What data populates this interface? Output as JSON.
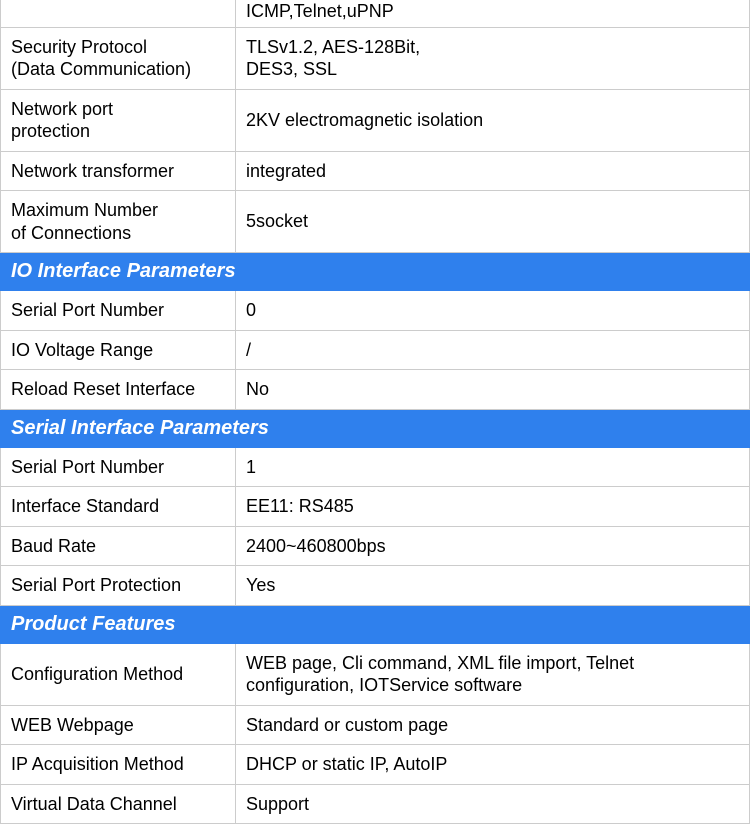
{
  "top_partial": {
    "label": "",
    "value": "ICMP,Telnet,uPNP"
  },
  "pre_rows": [
    {
      "label": "Security Protocol\n(Data Communication)",
      "value": "TLSv1.2, AES-128Bit,\nDES3, SSL"
    },
    {
      "label": "Network port\nprotection",
      "value": "2KV electromagnetic isolation"
    },
    {
      "label": "Network transformer",
      "value": "integrated"
    },
    {
      "label": "Maximum Number\nof Connections",
      "value": "5socket"
    }
  ],
  "sections": [
    {
      "title": "IO Interface Parameters",
      "rows": [
        {
          "label": "Serial Port Number",
          "value": "0"
        },
        {
          "label": "IO Voltage Range",
          "value": "/"
        },
        {
          "label": "Reload Reset Interface",
          "value": "No"
        }
      ]
    },
    {
      "title": "Serial Interface Parameters",
      "rows": [
        {
          "label": "Serial Port Number",
          "value": "1"
        },
        {
          "label": "Interface Standard",
          "value": "EE11: RS485"
        },
        {
          "label": "Baud Rate",
          "value": "2400~460800bps"
        },
        {
          "label": "Serial Port Protection",
          "value": "Yes"
        }
      ]
    },
    {
      "title": "Product Features",
      "rows": [
        {
          "label": "Configuration Method",
          "value": "WEB page, Cli command, XML file import, Telnet configuration, IOTService software"
        },
        {
          "label": "WEB Webpage",
          "value": "Standard or custom page"
        },
        {
          "label": "IP Acquisition Method",
          "value": "DHCP or static IP, AutoIP"
        },
        {
          "label": "Virtual Data Channel",
          "value": "Support"
        }
      ]
    }
  ]
}
